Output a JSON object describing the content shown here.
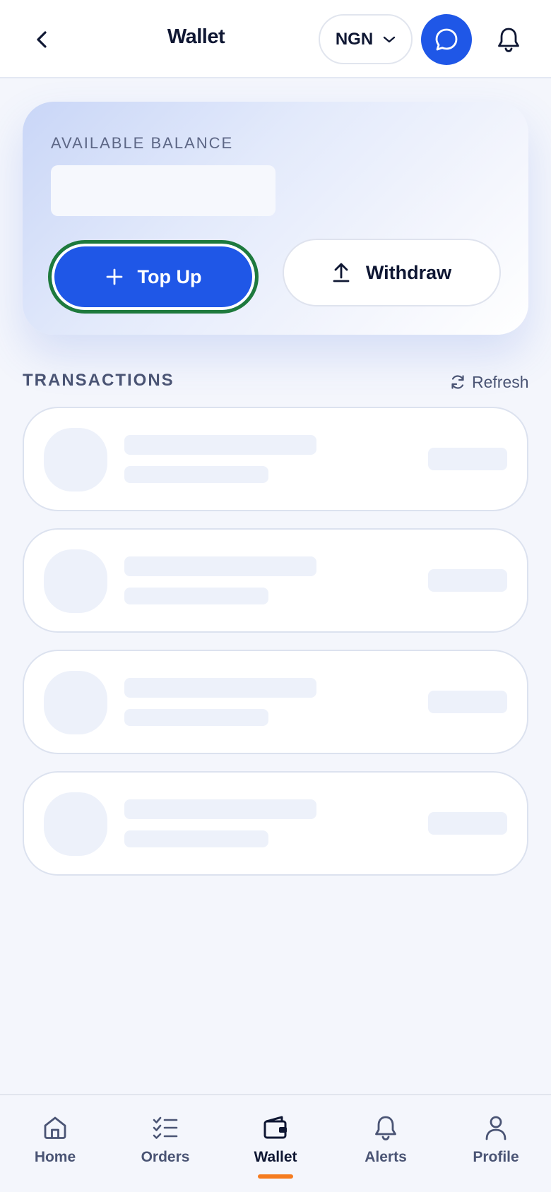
{
  "header": {
    "title": "Wallet",
    "currency": "NGN",
    "icons": {
      "back": "chevron-left-icon",
      "chat": "chat-bubble-icon",
      "notifications": "bell-icon"
    }
  },
  "balance": {
    "label": "AVAILABLE BALANCE",
    "amount_loading": true
  },
  "actions": {
    "topup_label": "Top Up",
    "withdraw_label": "Withdraw"
  },
  "transactions": {
    "heading": "TRANSACTIONS",
    "refresh_label": "Refresh",
    "loading_rows": 4
  },
  "nav": {
    "items": [
      {
        "label": "Home",
        "icon": "home-icon",
        "active": false
      },
      {
        "label": "Orders",
        "icon": "checklist-icon",
        "active": false
      },
      {
        "label": "Wallet",
        "icon": "wallet-icon",
        "active": true
      },
      {
        "label": "Alerts",
        "icon": "bell-icon",
        "active": false
      },
      {
        "label": "Profile",
        "icon": "person-icon",
        "active": false
      }
    ]
  },
  "colors": {
    "accent": "#1f57e7",
    "focus_ring": "#1e7a3d",
    "nav_indicator": "#f57c1f",
    "text_primary": "#0f1733",
    "text_muted": "#4a5474"
  }
}
